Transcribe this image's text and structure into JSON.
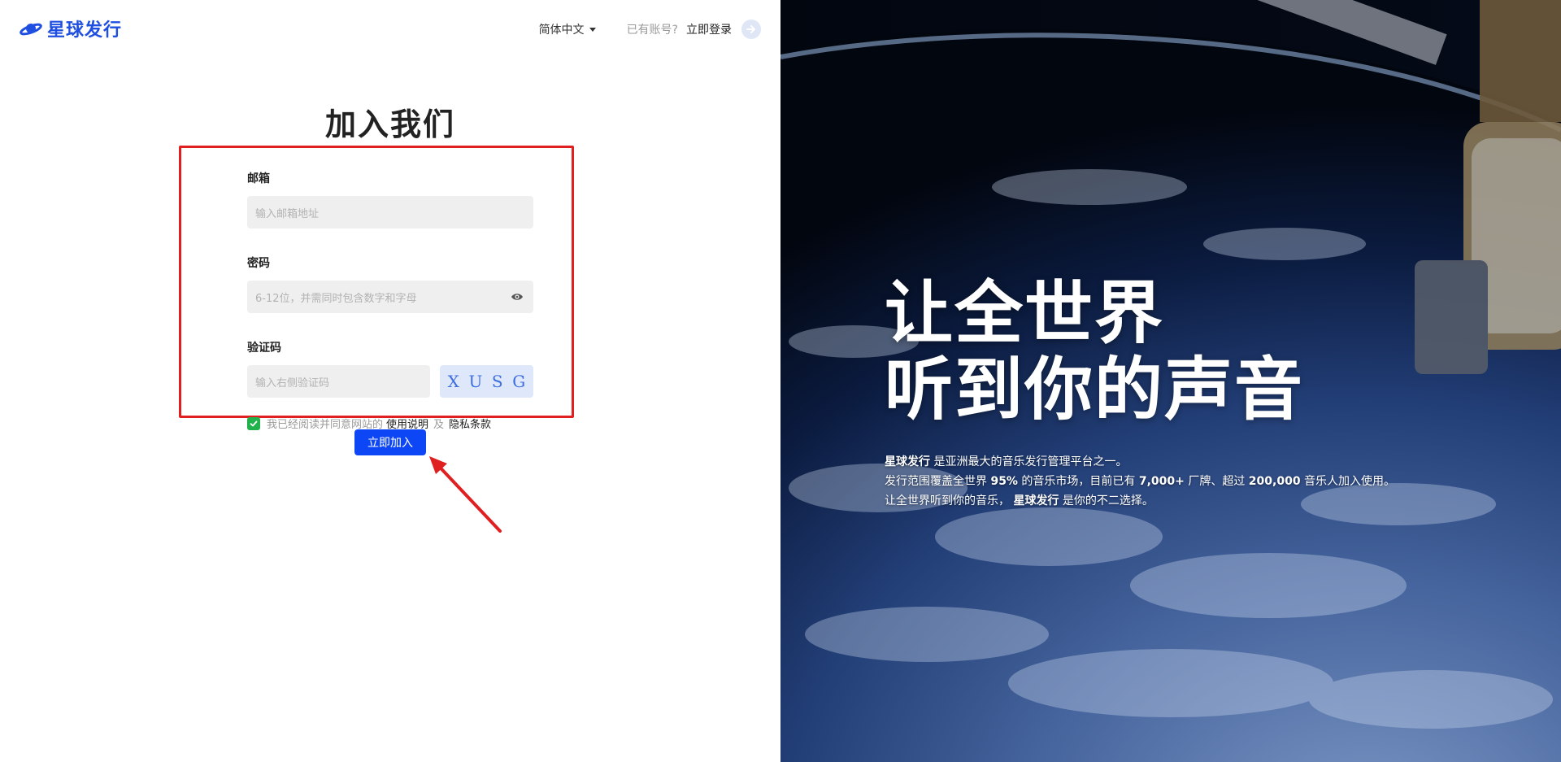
{
  "brand": {
    "name": "星球发行",
    "color": "#1f4fe0"
  },
  "header": {
    "language": "简体中文",
    "has_account": "已有账号?",
    "login": "立即登录"
  },
  "page_title": "加入我们",
  "form": {
    "email_label": "邮箱",
    "email_placeholder": "输入邮箱地址",
    "password_label": "密码",
    "password_placeholder": "6-12位，并需同时包含数字和字母",
    "captcha_label": "验证码",
    "captcha_placeholder": "输入右侧验证码",
    "captcha_chars": [
      "X",
      "U",
      "S",
      "G"
    ],
    "agree_prefix": "我已经阅读并同意网站的",
    "terms_link": "使用说明",
    "and": "及",
    "privacy_link": "隐私条款",
    "agree_checked": true
  },
  "submit_label": "立即加入",
  "hero": {
    "line1": "让全世界",
    "line2": "听到你的声音",
    "desc1_brand": "星球发行",
    "desc1_rest": "是亚洲最大的音乐发行管理平台之一。",
    "desc2_a": "发行范围覆盖全世界",
    "desc2_pct": "95%",
    "desc2_b": "的音乐市场，目前已有",
    "desc2_brands": "7,000+",
    "desc2_c": "厂牌、超过",
    "desc2_musicians": "200,000",
    "desc2_d": "音乐人加入使用。",
    "desc3_a": "让全世界听到你的音乐，",
    "desc3_brand": "星球发行",
    "desc3_b": "是你的不二选择。"
  },
  "colors": {
    "accent": "#0d47f5",
    "highlight_border": "#e02020",
    "checkbox": "#22b24c"
  }
}
